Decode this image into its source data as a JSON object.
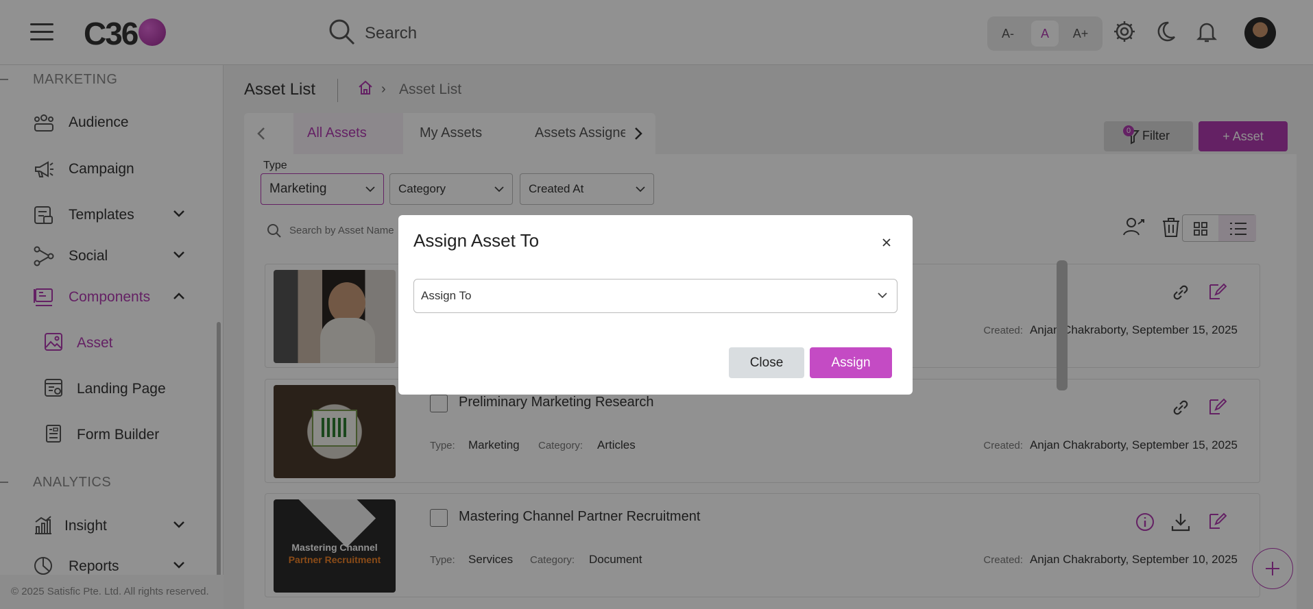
{
  "header": {
    "logo_text": "C36",
    "search_placeholder": "Search",
    "font_small": "A-",
    "font_normal": "A",
    "font_large": "A+"
  },
  "sidebar": {
    "section_marketing": "MARKETING",
    "section_analytics": "ANALYTICS",
    "items": [
      {
        "label": "Audience",
        "icon": "audience-icon"
      },
      {
        "label": "Campaign",
        "icon": "megaphone-icon"
      },
      {
        "label": "Templates",
        "icon": "templates-icon"
      },
      {
        "label": "Social",
        "icon": "share-icon"
      },
      {
        "label": "Components",
        "icon": "components-icon"
      },
      {
        "label": "Asset",
        "icon": "image-icon"
      },
      {
        "label": "Landing Page",
        "icon": "landing-page-icon"
      },
      {
        "label": "Form Builder",
        "icon": "form-icon"
      },
      {
        "label": "Insight",
        "icon": "chart-icon"
      },
      {
        "label": "Reports",
        "icon": "pie-chart-icon"
      }
    ],
    "copyright": "© 2025 Satisfic Pte. Ltd. All rights reserved."
  },
  "page": {
    "title": "Asset List",
    "breadcrumb_current": "Asset List",
    "tabs": [
      "All Assets",
      "My Assets",
      "Assets Assigne"
    ],
    "filter_label": "Filter",
    "filter_count": "0",
    "add_asset_label": "+ Asset",
    "type_label": "Type",
    "type_value": "Marketing",
    "category_placeholder": "Category",
    "created_placeholder": "Created At",
    "asset_search_placeholder": "Search by Asset Name"
  },
  "labels": {
    "type": "Type:",
    "category": "Category:",
    "created": "Created:"
  },
  "assets": [
    {
      "title": "",
      "type": "",
      "category": "",
      "created": "Anjan Chakraborty, September 15, 2025"
    },
    {
      "title": "Preliminary Marketing Research",
      "type": "Marketing",
      "category": "Articles",
      "created": "Anjan Chakraborty, September 15, 2025"
    },
    {
      "title": "Mastering Channel Partner Recruitment",
      "type": "Services",
      "category": "Document",
      "created": "Anjan Chakraborty, September 10, 2025",
      "thumb_line1": "Mastering Channel",
      "thumb_line2": "Partner Recruitment"
    }
  ],
  "modal": {
    "title": "Assign Asset To",
    "select_placeholder": "Assign To",
    "close_label": "Close",
    "assign_label": "Assign"
  },
  "colors": {
    "accent": "#b03ab0"
  }
}
